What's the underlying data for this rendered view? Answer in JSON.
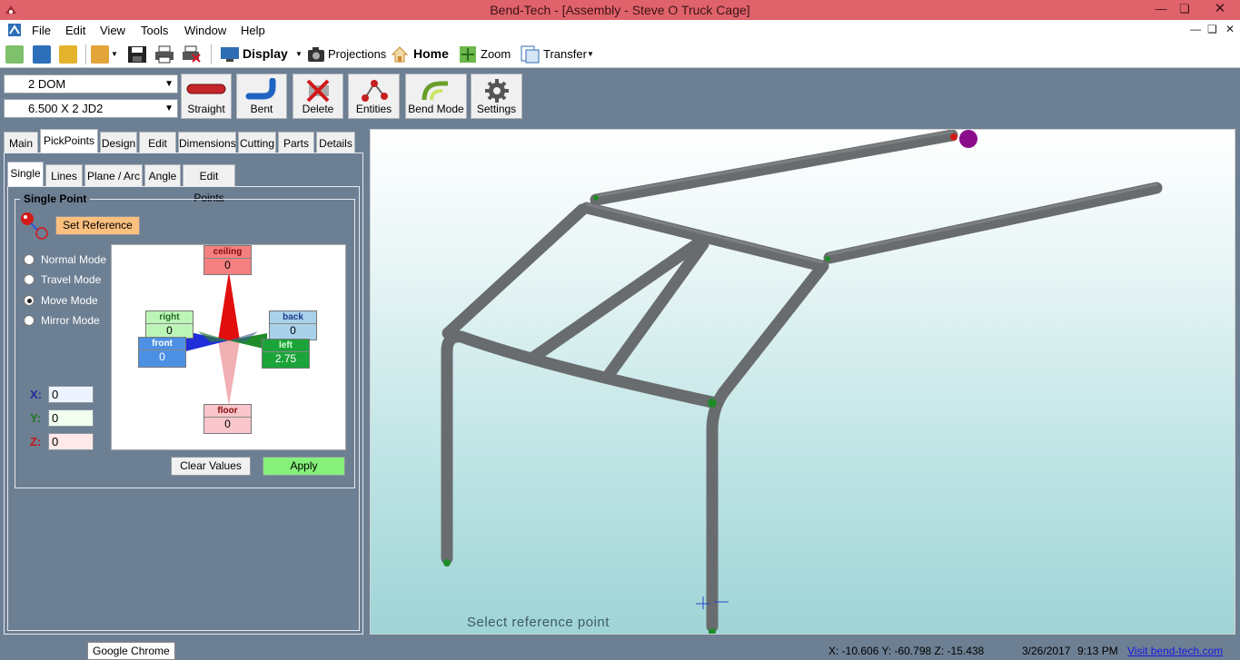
{
  "window": {
    "title": "Bend-Tech - [Assembly - Steve O Truck Cage]",
    "controls": [
      "minimize",
      "restore",
      "close"
    ]
  },
  "menu": {
    "items": [
      "File",
      "Edit",
      "View",
      "Tools",
      "Window",
      "Help"
    ]
  },
  "toolbar": {
    "display_label": "Display",
    "projections_label": "Projections",
    "home_label": "Home",
    "zoom_label": "Zoom",
    "transfer_label": "Transfer"
  },
  "ribbon": {
    "material_value": "2 DOM",
    "die_value": "6.500 X 2 JD2",
    "buttons": [
      "Straight",
      "Bent",
      "Delete",
      "Entities",
      "Bend Mode",
      "Settings"
    ]
  },
  "tabs": [
    "Main",
    "PickPoints",
    "Design",
    "Edit",
    "Dimensions",
    "Cutting",
    "Parts",
    "Details"
  ],
  "subtabs": [
    "Single",
    "Lines",
    "Plane / Arc",
    "Angle",
    "Edit Points"
  ],
  "single_point": {
    "group_title": "Single Point",
    "set_reference_label": "Set Reference",
    "modes": [
      "Normal Mode",
      "Travel Mode",
      "Move Mode",
      "Mirror Mode"
    ],
    "selected_mode": "Move Mode",
    "directions": {
      "ceiling": {
        "label": "ceiling",
        "value": "0"
      },
      "right": {
        "label": "right",
        "value": "0"
      },
      "back": {
        "label": "back",
        "value": "0"
      },
      "front": {
        "label": "front",
        "value": "0"
      },
      "left": {
        "label": "left",
        "value": "2.75"
      },
      "floor": {
        "label": "floor",
        "value": "0"
      }
    },
    "x_label": "X:",
    "x_value": "0",
    "y_label": "Y:",
    "y_value": "0",
    "z_label": "Z:",
    "z_value": "0",
    "clear_label": "Clear Values",
    "apply_label": "Apply"
  },
  "viewport": {
    "prompt": "Select reference point"
  },
  "statusbar": {
    "taskbar_tooltip": "Google Chrome",
    "coordinates": "X: -10.606  Y: -60.798  Z: -15.438",
    "date": "3/26/2017",
    "time": "9:13 PM",
    "link": "Visit bend-tech.com"
  },
  "colors": {
    "titlebar": "#e0626b",
    "panel_bg": "#6d7f93",
    "tube": "#6b6e70",
    "node": "#1f8c2a",
    "apply_green": "#86f07a",
    "set_reference_orange": "#fbbf7e"
  }
}
